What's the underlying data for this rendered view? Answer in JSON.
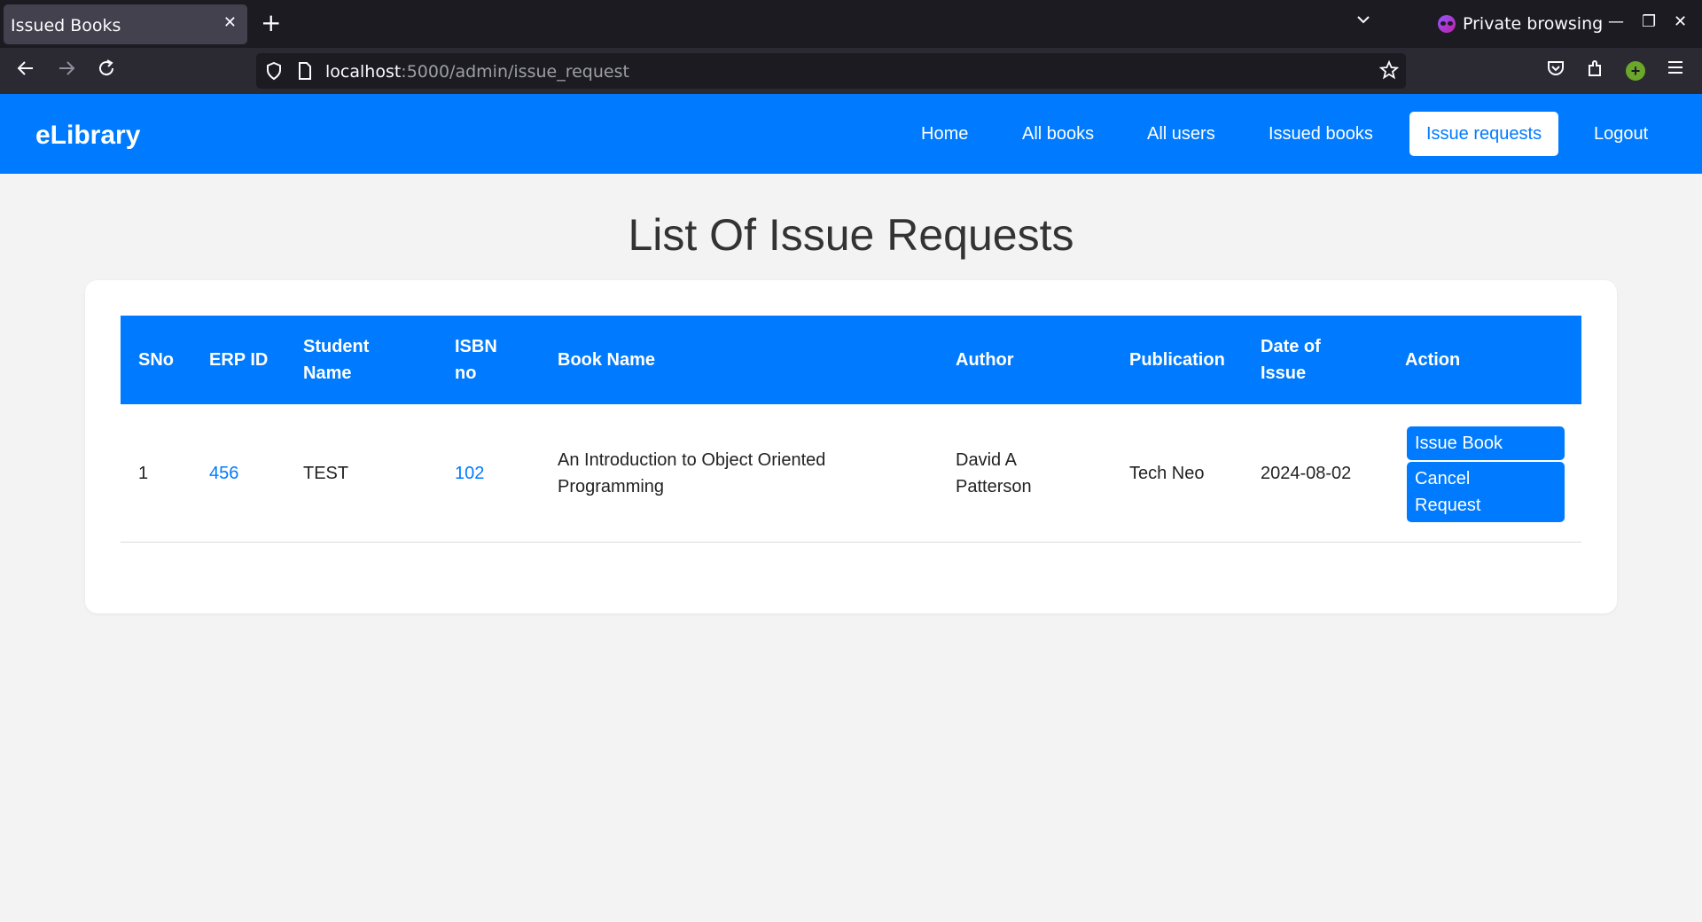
{
  "browser": {
    "tab_title": "Issued Books",
    "private_label": "Private browsing",
    "url_host": "localhost",
    "url_path": ":5000/admin/issue_request"
  },
  "app": {
    "brand": "eLibrary",
    "menu": [
      {
        "label": "Home"
      },
      {
        "label": "All books"
      },
      {
        "label": "All users"
      },
      {
        "label": "Issued books"
      },
      {
        "label": "Issue requests",
        "active": true
      },
      {
        "label": "Logout"
      }
    ],
    "accent_color": "#007bff"
  },
  "page": {
    "title": "List Of Issue Requests"
  },
  "table": {
    "headers": [
      "SNo",
      "ERP ID",
      "Student Name",
      "ISBN no",
      "Book Name",
      "Author",
      "Publication",
      "Date of Issue",
      "Action"
    ],
    "rows": [
      {
        "sno": "1",
        "erp_id": "456",
        "student_name": "TEST",
        "isbn": "102",
        "book_name": "An Introduction to Object Oriented Programming",
        "author": "David A Patterson",
        "publication": "Tech Neo",
        "date_of_issue": "2024-08-02",
        "actions": {
          "issue": "Issue Book",
          "cancel": "Cancel Request"
        }
      }
    ]
  },
  "icons": [
    "close-icon",
    "plus-icon",
    "chevron-down-icon",
    "private-browsing-icon",
    "minimize-icon",
    "restore-icon",
    "back-icon",
    "forward-icon",
    "reload-icon",
    "shield-icon",
    "page-icon",
    "star-icon",
    "pocket-icon",
    "extensions-icon",
    "hamburger-menu-icon"
  ]
}
